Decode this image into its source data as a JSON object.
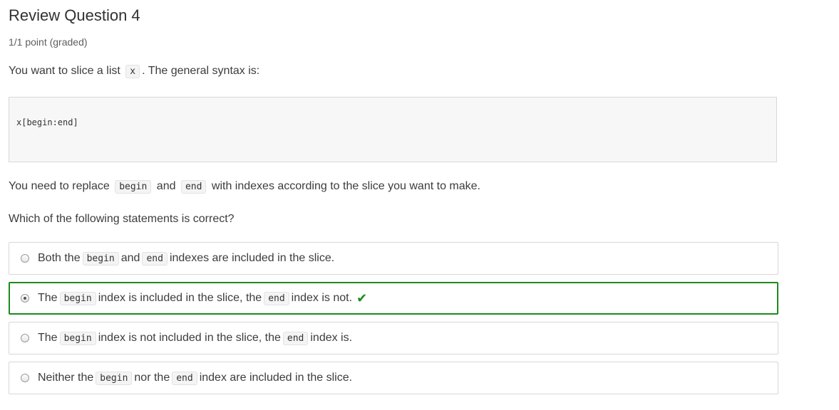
{
  "problem": {
    "title": "Review Question 4",
    "points": "1/1 point (graded)",
    "intro_before": "You want to slice a list",
    "intro_code": "x",
    "intro_after": ". The general syntax is:",
    "code_block": "x[begin:end]",
    "replace_before": "You need to replace",
    "replace_code1": "begin",
    "replace_mid": "and",
    "replace_code2": "end",
    "replace_after": "with indexes according to the slice you want to make.",
    "question": "Which of the following statements is correct?"
  },
  "options": [
    {
      "t1": "Both the",
      "c1": "begin",
      "t2": "and",
      "c2": "end",
      "t3": "indexes are included in the slice.",
      "selected": false
    },
    {
      "t1": "The",
      "c1": "begin",
      "t2": "index is included in the slice, the",
      "c2": "end",
      "t3": "index is not.",
      "selected": true,
      "correct": true
    },
    {
      "t1": "The",
      "c1": "begin",
      "t2": "index is not included in the slice, the",
      "c2": "end",
      "t3": "index is.",
      "selected": false
    },
    {
      "t1": "Neither the",
      "c1": "begin",
      "t2": "nor the",
      "c2": "end",
      "t3": "index are included in the slice.",
      "selected": false
    }
  ],
  "icons": {
    "correct_mark": "checkmark-icon",
    "correct_color": "#1d8a1d"
  }
}
